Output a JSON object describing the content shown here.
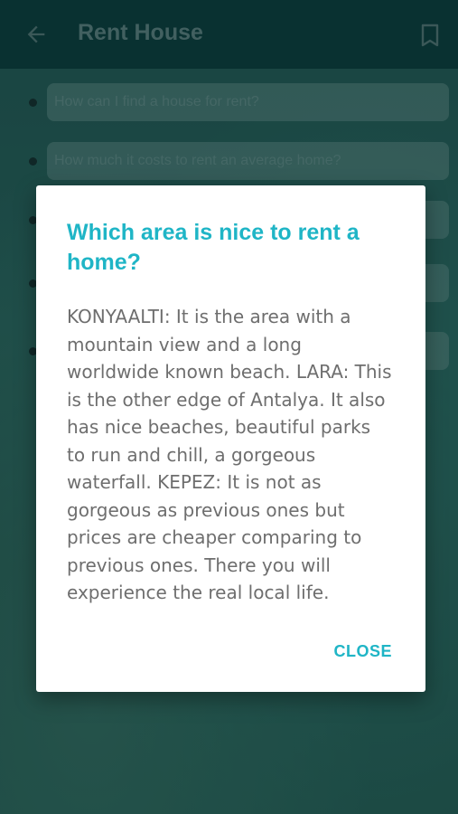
{
  "appbar": {
    "title": "Rent House",
    "back_icon": "back-arrow-icon",
    "bookmark_icon": "bookmark-icon"
  },
  "questions": [
    "How can I find a house for rent?",
    "How much it costs to rent an average home?"
  ],
  "dialog": {
    "title": "Which area is nice to rent a home?",
    "body": "KONYAALTI: It is the area with a mountain view and a long worldwide known beach. LARA: This is the other edge of Antalya. It also has nice beaches, beautiful parks to run and chill, a gorgeous waterfall. KEPEZ: It is not as gorgeous as previous ones but prices are cheaper comparing to previous ones. There you will experience the real local life.",
    "close_label": "CLOSE"
  },
  "colors": {
    "accent": "#1fb5c6",
    "appbar": "#0f4f50"
  }
}
